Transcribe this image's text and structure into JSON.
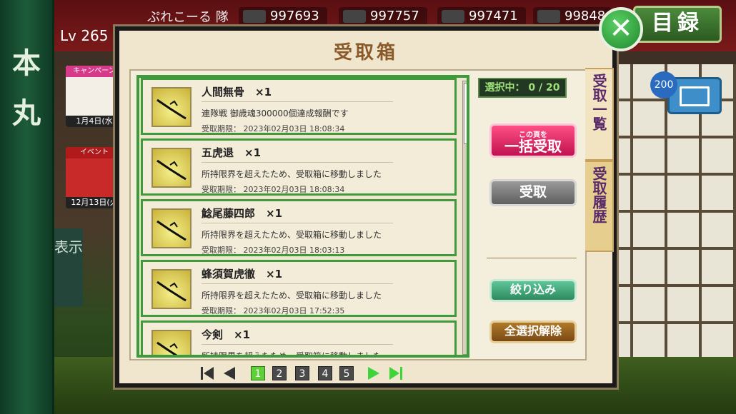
{
  "header": {
    "squad_label": "ぷれこーる 隊",
    "level": "Lv 265",
    "resources": [
      "997693",
      "997757",
      "997471",
      "99848"
    ],
    "catalog_label": "目録"
  },
  "sidebar": {
    "title_chars": [
      "本",
      "丸"
    ]
  },
  "banners": [
    {
      "tag": "キャンペーン",
      "date": "1月4日(水"
    },
    {
      "tag": "イベント",
      "date": "12月13日(火"
    }
  ],
  "show_tab": {
    "label": "表示"
  },
  "mail": {
    "badge": "200"
  },
  "modal": {
    "title": "受取箱",
    "selection": "選択中： 0 / 20",
    "bulk_small": "この頁を",
    "bulk_big": "一括受取",
    "receive_label": "受取",
    "filter_label": "絞り込み",
    "deselect_label": "全選択解除",
    "tab_list": "受取一覧",
    "tab_history": "受取履歴"
  },
  "items": [
    {
      "name": "人間無骨　×1",
      "desc": "連隊戦 御歳魂300000個達成報酬です",
      "date": "受取期限：  2023年02月03日 18:08:34"
    },
    {
      "name": "五虎退　×1",
      "desc": "所持限界を超えたため、受取箱に移動しました",
      "date": "受取期限：  2023年02月03日 18:08:34"
    },
    {
      "name": "鯰尾藤四郎　×1",
      "desc": "所持限界を超えたため、受取箱に移動しました",
      "date": "受取期限：  2023年02月03日 18:03:13"
    },
    {
      "name": "蜂須賀虎徹　×1",
      "desc": "所持限界を超えたため、受取箱に移動しました",
      "date": "受取期限：  2023年02月03日 17:52:35"
    },
    {
      "name": "今剣　×1",
      "desc": "所持限界を超えたため、受取箱に移動しました",
      "date": ""
    }
  ],
  "pagination": {
    "pages": [
      "1",
      "2",
      "3",
      "4",
      "5"
    ],
    "current": "1"
  },
  "colors": {
    "accent_green": "#3e9a3a",
    "bulk_pink": "#e0206a",
    "close_green": "#2fa03e"
  }
}
